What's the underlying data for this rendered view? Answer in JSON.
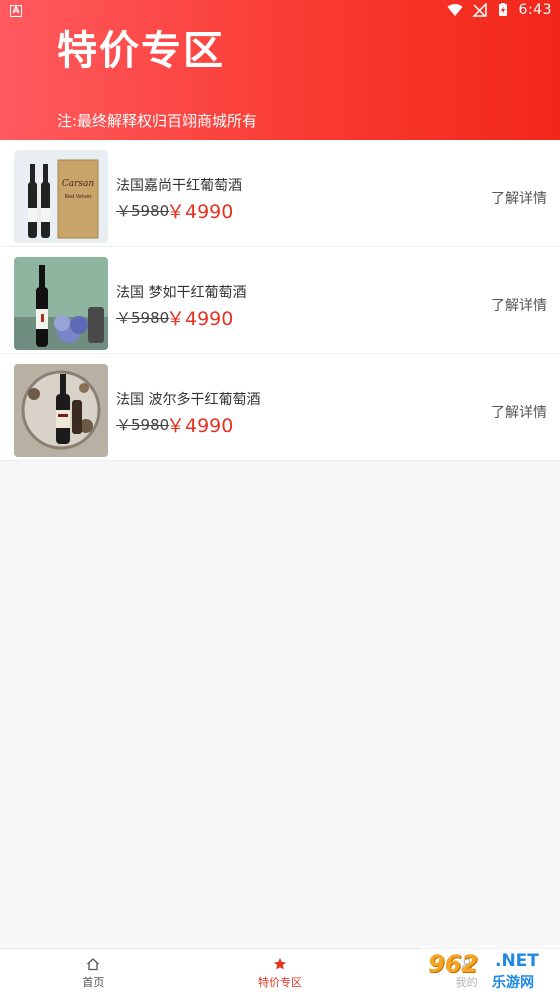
{
  "status_bar": {
    "time": "6:43",
    "left_icon": "A"
  },
  "header": {
    "title": "特价专区",
    "notice": "注:最终解释权归百翊商城所有"
  },
  "items": [
    {
      "name": "法国嘉尚干红葡萄酒",
      "price_old": "￥5980",
      "price_new": "￥4990",
      "detail": "了解详情"
    },
    {
      "name": "法国 梦如干红葡萄酒",
      "price_old": "￥5980",
      "price_new": "￥4990",
      "detail": "了解详情"
    },
    {
      "name": "法国 波尔多干红葡萄酒",
      "price_old": "￥5980",
      "price_new": "￥4990",
      "detail": "了解详情"
    }
  ],
  "tabbar": {
    "tabs": [
      {
        "label": "首页",
        "icon": "home-icon",
        "active": false
      },
      {
        "label": "特价专区",
        "icon": "star-icon",
        "active": true
      },
      {
        "label": "我的",
        "icon": "user-icon",
        "active": false
      }
    ]
  },
  "watermark": {
    "number": "962",
    "suffix": ".NET",
    "site": "乐游网"
  },
  "colors": {
    "accent": "#e53223",
    "header_start": "#ff5a5f",
    "header_end": "#f2271a"
  }
}
